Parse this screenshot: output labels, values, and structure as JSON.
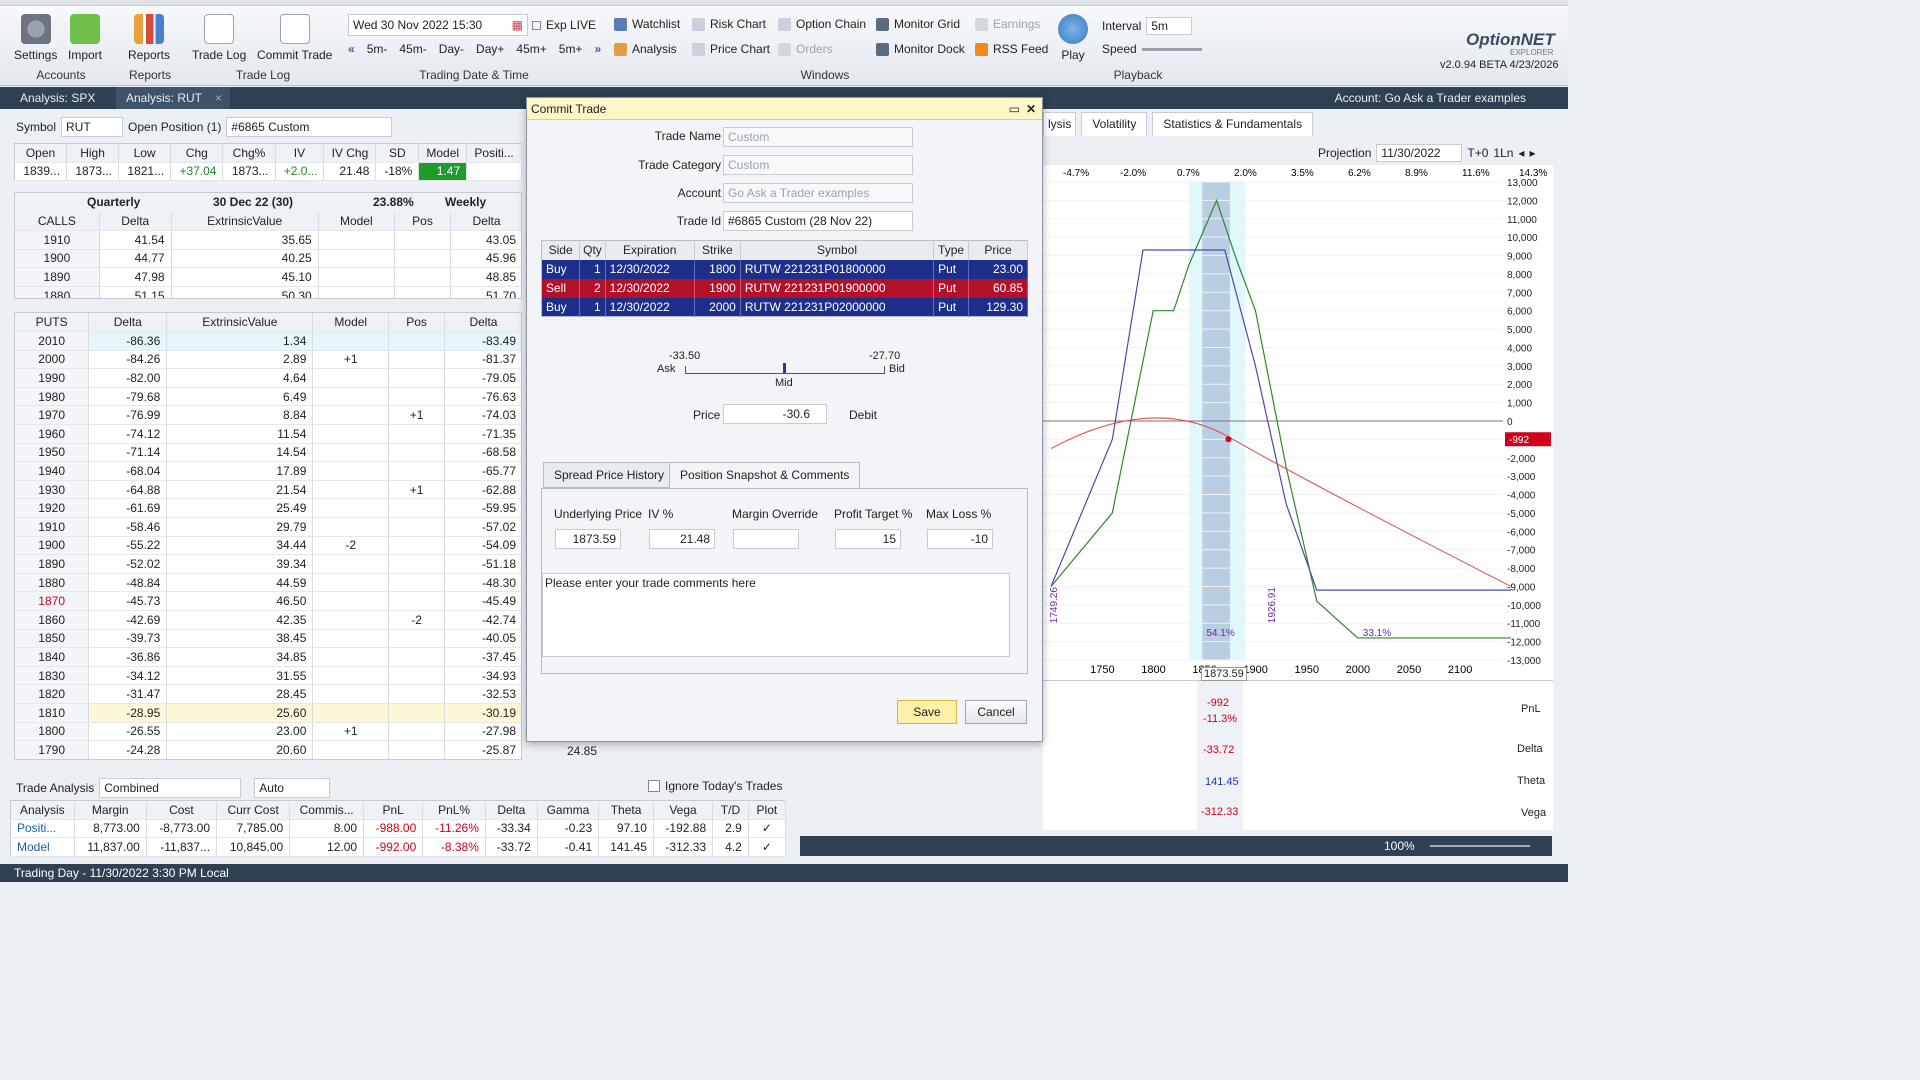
{
  "ribbon": {
    "settings": "Settings",
    "import": "Import",
    "reports": "Reports",
    "trade_log": "Trade Log",
    "commit_trade": "Commit Trade",
    "accounts_group": "Accounts",
    "reports_group": "Reports",
    "trade_log_group": "Trade Log",
    "date_value": "Wed 30 Nov 2022 15:30",
    "exp_live": "Exp LIVE",
    "nav": [
      "5m-",
      "45m-",
      "Day-",
      "Day+",
      "45m+",
      "5m+"
    ],
    "date_group": "Trading Date & Time",
    "windows": {
      "watchlist": "Watchlist",
      "risk_chart": "Risk Chart",
      "option_chain": "Option Chain",
      "monitor_grid": "Monitor Grid",
      "earnings": "Earnings",
      "analysis": "Analysis",
      "price_chart": "Price Chart",
      "orders": "Orders",
      "monitor_dock": "Monitor Dock",
      "rss_feed": "RSS Feed"
    },
    "windows_group": "Windows",
    "play": "Play",
    "interval_label": "Interval",
    "interval_value": "5m",
    "speed_label": "Speed",
    "playback_group": "Playback",
    "logo": "OptionNET",
    "logo_sub": "EXPLORER",
    "version": "v2.0.94 BETA 4/23/2026"
  },
  "tabs": {
    "t1": "Analysis: SPX",
    "t2": "Analysis: RUT",
    "account": "Account: Go Ask a Trader examples"
  },
  "symbol_bar": {
    "symbol_label": "Symbol",
    "symbol": "RUT",
    "open_pos": "Open Position (1)",
    "position": "#6865 Custom"
  },
  "quote": {
    "headers": [
      "Open",
      "High",
      "Low",
      "Chg",
      "Chg%",
      "IV",
      "IV Chg",
      "SD",
      "Model",
      "Positi..."
    ],
    "values": [
      "1839...",
      "1873...",
      "1821...",
      "+37.04",
      "1873...",
      "+2.0...",
      "21.48",
      "-18%",
      "1.47",
      "",
      ""
    ]
  },
  "calls": {
    "title": "Quarterly",
    "exp": "30 Dec 22 (30)",
    "iv": "23.88%",
    "weekly": "Weekly",
    "label": "CALLS",
    "headers": [
      "Delta",
      "ExtrinsicValue",
      "Model",
      "Pos",
      "Delta"
    ],
    "rows": [
      [
        "1910",
        "41.54",
        "35.65",
        "",
        "",
        "43.05"
      ],
      [
        "1900",
        "44.77",
        "40.25",
        "",
        "",
        "45.96"
      ],
      [
        "1890",
        "47.98",
        "45.10",
        "",
        "",
        "48.85"
      ],
      [
        "1880",
        "51.15",
        "50.30",
        "",
        "",
        "51.70"
      ]
    ]
  },
  "puts": {
    "label": "PUTS",
    "headers": [
      "Delta",
      "ExtrinsicValue",
      "Model",
      "Pos",
      "Delta"
    ],
    "rows": [
      [
        "2010",
        "-86.36",
        "1.34",
        "",
        "",
        "-83.49"
      ],
      [
        "2000",
        "-84.26",
        "2.89",
        "+1",
        "",
        "-81.37"
      ],
      [
        "1990",
        "-82.00",
        "4.64",
        "",
        "",
        "-79.05"
      ],
      [
        "1980",
        "-79.68",
        "6.49",
        "",
        "",
        "-76.63"
      ],
      [
        "1970",
        "-76.99",
        "8.84",
        "",
        "+1",
        "-74.03"
      ],
      [
        "1960",
        "-74.12",
        "11.54",
        "",
        "",
        "-71.35"
      ],
      [
        "1950",
        "-71.14",
        "14.54",
        "",
        "",
        "-68.58"
      ],
      [
        "1940",
        "-68.04",
        "17.89",
        "",
        "",
        "-65.77"
      ],
      [
        "1930",
        "-64.88",
        "21.54",
        "",
        "+1",
        "-62.88"
      ],
      [
        "1920",
        "-61.69",
        "25.49",
        "",
        "",
        "-59.95"
      ],
      [
        "1910",
        "-58.46",
        "29.79",
        "",
        "",
        "-57.02"
      ],
      [
        "1900",
        "-55.22",
        "34.44",
        "-2",
        "",
        "-54.09"
      ],
      [
        "1890",
        "-52.02",
        "39.34",
        "",
        "",
        "-51.18"
      ],
      [
        "1880",
        "-48.84",
        "44.59",
        "",
        "",
        "-48.30"
      ],
      [
        "1870",
        "-45.73",
        "46.50",
        "",
        "",
        "-45.49"
      ],
      [
        "1860",
        "-42.69",
        "42.35",
        "",
        "-2",
        "-42.74"
      ],
      [
        "1850",
        "-39.73",
        "38.45",
        "",
        "",
        "-40.05"
      ],
      [
        "1840",
        "-36.86",
        "34.85",
        "",
        "",
        "-37.45"
      ],
      [
        "1830",
        "-34.12",
        "31.55",
        "",
        "",
        "-34.93"
      ],
      [
        "1820",
        "-31.47",
        "28.45",
        "",
        "",
        "-32.53"
      ],
      [
        "1810",
        "-28.95",
        "25.60",
        "",
        "",
        "-30.19"
      ],
      [
        "1800",
        "-26.55",
        "23.00",
        "+1",
        "",
        "-27.98"
      ],
      [
        "1790",
        "-24.28",
        "20.60",
        "",
        "",
        "-25.87"
      ]
    ],
    "extra": "24.85"
  },
  "trade_analysis": {
    "label": "Trade Analysis",
    "mode": "Combined",
    "auto": "Auto",
    "ignore": "Ignore Today's Trades",
    "headers": [
      "Analysis",
      "Margin",
      "Cost",
      "Curr Cost",
      "Commis...",
      "PnL",
      "PnL%",
      "Delta",
      "Gamma",
      "Theta",
      "Vega",
      "T/D",
      "Plot"
    ],
    "rows": [
      [
        "Positi...",
        "8,773.00",
        "-8,773.00",
        "7,785.00",
        "8.00",
        "-988.00",
        "-11.26%",
        "-33.34",
        "-0.23",
        "97.10",
        "-192.88",
        "2.9",
        "✓"
      ],
      [
        "Model",
        "11,837.00",
        "-11,837...",
        "10,845.00",
        "12.00",
        "-992.00",
        "-8.38%",
        "-33.72",
        "-0.41",
        "141.45",
        "-312.33",
        "4.2",
        "✓"
      ]
    ]
  },
  "dialog": {
    "title": "Commit Trade",
    "trade_name_label": "Trade Name",
    "trade_name": "Custom",
    "category_label": "Trade Category",
    "category": "Custom",
    "account_label": "Account",
    "account": "Go Ask a Trader examples",
    "trade_id_label": "Trade Id",
    "trade_id": "#6865 Custom (28 Nov 22)",
    "legs_headers": [
      "Side",
      "Qty",
      "Expiration",
      "Strike",
      "Symbol",
      "Type",
      "Price"
    ],
    "legs": [
      {
        "side": "Buy",
        "qty": "1",
        "exp": "12/30/2022",
        "strike": "1800",
        "symbol": "RUTW  221231P01800000",
        "type": "Put",
        "price": "23.00",
        "color": "#1d2f8a"
      },
      {
        "side": "Sell",
        "qty": "2",
        "exp": "12/30/2022",
        "strike": "1900",
        "symbol": "RUTW  221231P01900000",
        "type": "Put",
        "price": "60.85",
        "color": "#b3102a"
      },
      {
        "side": "Buy",
        "qty": "1",
        "exp": "12/30/2022",
        "strike": "2000",
        "symbol": "RUTW  221231P02000000",
        "type": "Put",
        "price": "129.30",
        "color": "#1d2f8a"
      }
    ],
    "ask_val": "-33.50",
    "bid_val": "-27.70",
    "ask": "Ask",
    "bid": "Bid",
    "mid": "Mid",
    "price_label": "Price",
    "price": "-30.6",
    "debit": "Debit",
    "tab1": "Spread Price History",
    "tab2": "Position Snapshot & Comments",
    "snap_headers": [
      "Underlying Price",
      "IV %",
      "Margin Override",
      "Profit Target %",
      "Max Loss %"
    ],
    "snap_values": [
      "1873.59",
      "21.48",
      "",
      "15",
      "-10"
    ],
    "comments": "Please enter your trade comments here",
    "save": "Save",
    "cancel": "Cancel"
  },
  "right": {
    "tabs": [
      "lysis",
      "Volatility",
      "Statistics & Fundamentals"
    ],
    "projection_label": "Projection",
    "projection": "11/30/2022",
    "t0": "T+0",
    "lines": "1Ln",
    "pct": [
      "-4.7%",
      "-2.0%",
      "0.7%",
      "2.0%",
      "3.5%",
      "6.2%",
      "8.9%",
      "11.6%",
      "14.3%"
    ],
    "y_ticks": [
      "13,000",
      "12,000",
      "11,000",
      "10,000",
      "9,000",
      "8,000",
      "7,000",
      "6,000",
      "5,000",
      "4,000",
      "3,000",
      "2,000",
      "1,000",
      "0",
      "-1,000",
      "-2,000",
      "-3,000",
      "-4,000",
      "-5,000",
      "-6,000",
      "-7,000",
      "-8,000",
      "-9,000",
      "-10,000",
      "-11,000",
      "-12,000",
      "-13,000"
    ],
    "x_ticks": [
      "1750",
      "1800",
      "1850",
      "1900",
      "1950",
      "2000",
      "2050",
      "2100"
    ],
    "pnl_marker": "-992",
    "left_v": "1749.26",
    "right_v": "1926.91",
    "prob": "54.1%",
    "prob2": "33.1%",
    "spot": "1873.59",
    "greeks": [
      "PnL",
      "Delta",
      "Theta",
      "Vega"
    ],
    "pnl_vals": [
      "-992",
      "-11.3%"
    ],
    "delta_val": "-33.72",
    "theta_val": "141.45",
    "vega_val": "-312.33",
    "zoom": "100%"
  },
  "status": "Trading Day - 11/30/2022 3:30 PM Local"
}
